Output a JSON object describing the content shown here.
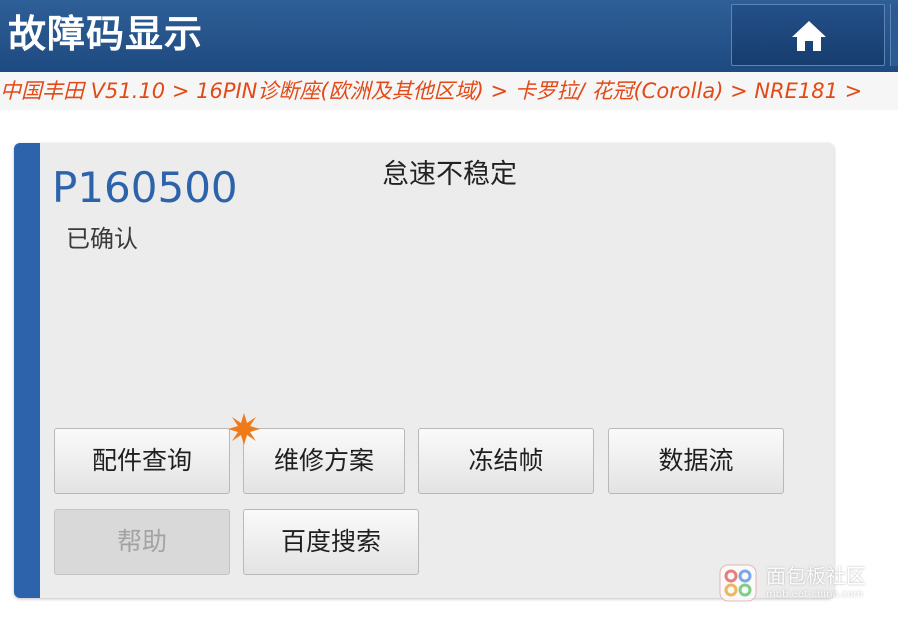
{
  "header": {
    "title": "故障码显示",
    "home_icon": "home-icon",
    "color": "#1d4a80"
  },
  "breadcrumb": {
    "text": "中国丰田 V51.10 > 16PIN诊断座(欧洲及其他区域) > 卡罗拉/ 花冠(Corolla) > NRE181 >",
    "color": "#e24a17"
  },
  "dtc": {
    "code": "P160500",
    "status": "已确认",
    "description": "怠速不稳定",
    "accent_color": "#2c63ab"
  },
  "buttons": {
    "parts": "配件查询",
    "repair": "维修方案",
    "freeze": "冻结帧",
    "datastream": "数据流",
    "help": "帮助",
    "baidu": "百度搜索",
    "repair_badge_icon": "new-star-icon"
  },
  "watermark": {
    "title": "面包板社区",
    "sub": "mbb.eet-china.com"
  }
}
